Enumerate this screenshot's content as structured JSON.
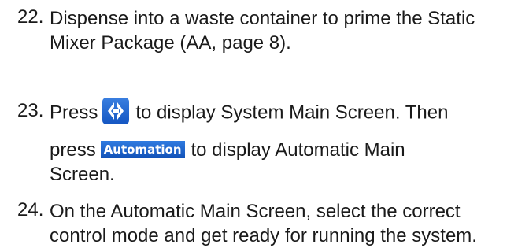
{
  "steps": [
    {
      "number": "22.",
      "lines": [
        "Dispense into a waste container to prime the Static",
        "Mixer Package (AA, page 8)."
      ]
    },
    {
      "number": "23.",
      "line1_before": "Press",
      "line1_after": "to display System Main Screen. Then",
      "line2_before": "press",
      "automation_button_label": "Automation",
      "line2_after": "to display Automatic Main",
      "line3": "Screen.",
      "home_button_icon": "graco-home-icon"
    },
    {
      "number": "24.",
      "lines": [
        "On the Automatic Main Screen, select the correct",
        "control mode and get ready for running the system."
      ]
    }
  ],
  "colors": {
    "button_blue": "#1e63d0",
    "text": "#1a1a1a"
  }
}
